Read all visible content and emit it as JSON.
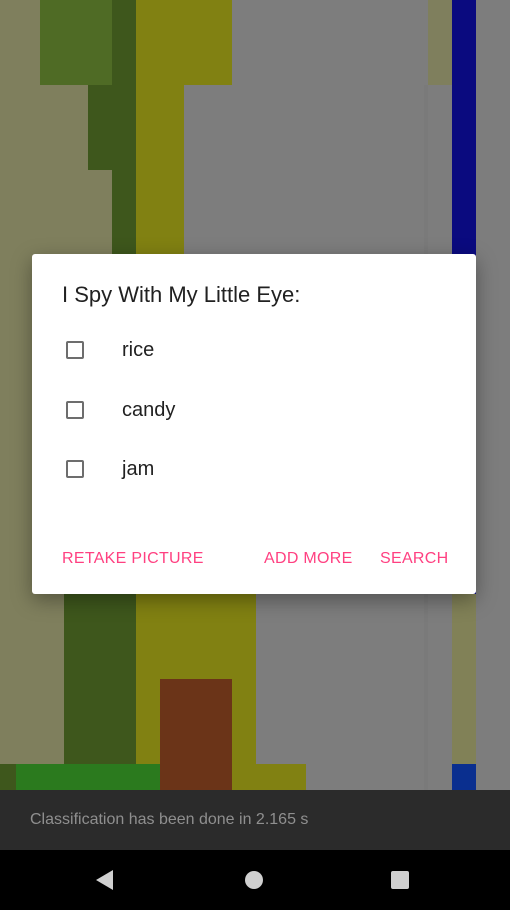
{
  "dialog": {
    "title": "I Spy With My Little Eye:",
    "options": [
      {
        "label": "rice",
        "checked": false
      },
      {
        "label": "candy",
        "checked": false
      },
      {
        "label": "jam",
        "checked": false
      }
    ],
    "buttons": {
      "retake": "RETAKE PICTURE",
      "add_more": "ADD MORE",
      "search": "SEARCH"
    },
    "accent_color": "#ff4081"
  },
  "snackbar": {
    "text": "Classification has been done in 2.165 s"
  },
  "navbar": {
    "icons": [
      "back-triangle-icon",
      "home-circle-icon",
      "recents-square-icon"
    ]
  }
}
